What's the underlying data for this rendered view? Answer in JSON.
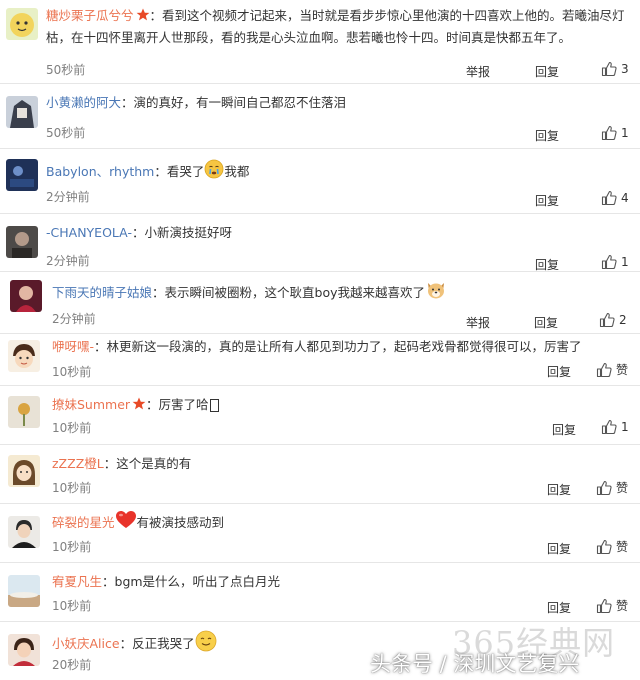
{
  "colors": {
    "username": "#eb7350",
    "username_alt": "#4a77b5",
    "text": "#333333",
    "time": "#808080"
  },
  "comments": [
    {
      "user": "糖炒栗子瓜兮兮",
      "text_line1": "：看到这个视频才记起来，当时就是看步步惊心里他演的十四喜欢上他的。若曦油尽灯",
      "text_line2": "枯，在十四怀里离开人世那段，看的我是心头泣血啊。悲若曦也怜十四。时间真是快都五年了。",
      "time": "50秒前",
      "report": "举报",
      "reply": "回复",
      "likes": "3"
    },
    {
      "user": "小黄濑的阿大",
      "text": "：演的真好，有一瞬间自己都忍不住落泪",
      "time": "50秒前",
      "reply": "回复",
      "likes": "1"
    },
    {
      "user": "Babylon、rhythm",
      "text": "：看哭了",
      "text_after": "我都",
      "time": "2分钟前",
      "reply": "回复",
      "likes": "4"
    },
    {
      "user": "-CHANYEOLA-",
      "text": "：小新演技挺好呀",
      "time": "2分钟前",
      "reply": "回复",
      "likes": "1"
    },
    {
      "user": "下雨天的晴子姑娘",
      "text": "：表示瞬间被圈粉，这个耿直boy我越来越喜欢了",
      "time": "2分钟前",
      "report": "举报",
      "reply": "回复",
      "likes": "2"
    },
    {
      "user": "咿呀嘿-",
      "text": "：林更新这一段演的，真的是让所有人都见到功力了，起码老戏骨都觉得很可以，厉害了",
      "time": "10秒前",
      "reply": "回复",
      "likes": "赞"
    },
    {
      "user": "撩妹Summer",
      "text": "：厉害了哈",
      "time": "10秒前",
      "reply": "回复",
      "likes": "1"
    },
    {
      "user": "zZZZ橙L",
      "text": "：这个是真的有",
      "time": "10秒前",
      "reply": "回复",
      "likes": "赞"
    },
    {
      "user": "碎裂的星光",
      "text": "有被演技感动到",
      "time": "10秒前",
      "reply": "回复",
      "likes": "赞"
    },
    {
      "user": "宥夏凡生",
      "text": "：bgm是什么，听出了点白月光",
      "time": "10秒前",
      "reply": "回复",
      "likes": "赞"
    },
    {
      "user": "小妖庆Alice",
      "text": "：反正我哭了",
      "time": "20秒前"
    }
  ],
  "watermark": {
    "site": "365经典网",
    "source": "头条号 / 深圳文艺复兴"
  }
}
